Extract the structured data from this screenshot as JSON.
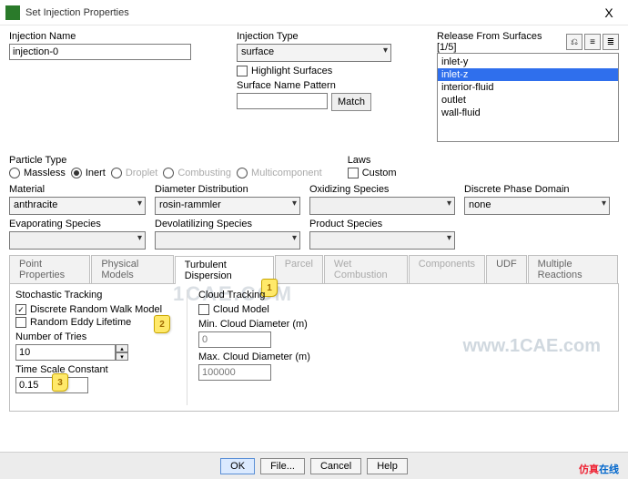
{
  "window": {
    "title": "Set Injection Properties",
    "close": "X"
  },
  "injection_name": {
    "label": "Injection Name",
    "value": "injection-0"
  },
  "injection_type": {
    "label": "Injection Type",
    "value": "surface",
    "highlight_label": "Highlight Surfaces",
    "highlight_checked": false,
    "pattern_label": "Surface Name Pattern",
    "pattern_value": "",
    "match_btn": "Match"
  },
  "release": {
    "label": "Release From Surfaces [1/5]",
    "items": [
      "inlet-y",
      "inlet-z",
      "interior-fluid",
      "outlet",
      "wall-fluid"
    ],
    "selected_index": 1
  },
  "particle_type": {
    "label": "Particle Type",
    "options": [
      "Massless",
      "Inert",
      "Droplet",
      "Combusting",
      "Multicomponent"
    ],
    "selected": 1
  },
  "laws": {
    "label": "Laws",
    "custom_label": "Custom",
    "custom_checked": false
  },
  "material": {
    "label": "Material",
    "value": "anthracite"
  },
  "diameter_dist": {
    "label": "Diameter Distribution",
    "value": "rosin-rammler"
  },
  "oxidizing": {
    "label": "Oxidizing Species",
    "value": ""
  },
  "discrete_domain": {
    "label": "Discrete Phase Domain",
    "value": "none"
  },
  "evaporating": {
    "label": "Evaporating Species",
    "value": ""
  },
  "devolatilizing": {
    "label": "Devolatilizing Species",
    "value": ""
  },
  "product": {
    "label": "Product Species",
    "value": ""
  },
  "tabs": [
    {
      "label": "Point Properties",
      "state": "normal"
    },
    {
      "label": "Physical Models",
      "state": "normal"
    },
    {
      "label": "Turbulent Dispersion",
      "state": "active"
    },
    {
      "label": "Parcel",
      "state": "disabled"
    },
    {
      "label": "Wet Combustion",
      "state": "disabled"
    },
    {
      "label": "Components",
      "state": "disabled"
    },
    {
      "label": "UDF",
      "state": "normal"
    },
    {
      "label": "Multiple Reactions",
      "state": "normal"
    }
  ],
  "stochastic": {
    "title": "Stochastic Tracking",
    "drwm_label": "Discrete Random Walk Model",
    "drwm_checked": true,
    "rel_label": "Random Eddy Lifetime",
    "rel_checked": false,
    "tries_label": "Number of Tries",
    "tries_value": "10",
    "tsc_label": "Time Scale Constant",
    "tsc_value": "0.15"
  },
  "cloud": {
    "title": "Cloud Tracking",
    "model_label": "Cloud Model",
    "model_checked": false,
    "min_label": "Min. Cloud Diameter (m)",
    "min_value": "0",
    "max_label": "Max. Cloud Diameter (m)",
    "max_value": "100000"
  },
  "markers": {
    "m1": "1",
    "m2": "2",
    "m3": "3"
  },
  "buttons": {
    "ok": "OK",
    "file": "File...",
    "cancel": "Cancel",
    "help": "Help"
  },
  "watermarks": {
    "center": "1CAE.COM",
    "url": "www.1CAE.com",
    "brand_cn": "仿真在线"
  }
}
